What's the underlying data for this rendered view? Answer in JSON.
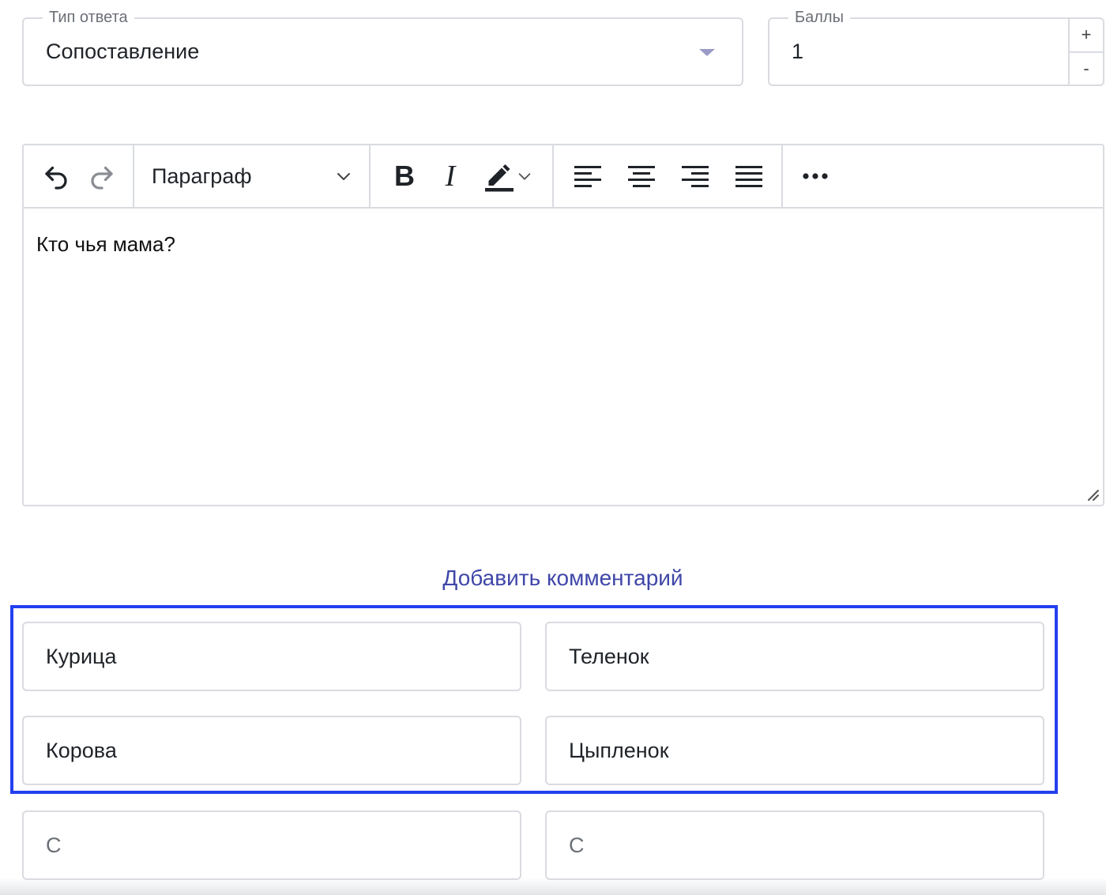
{
  "answer_type": {
    "legend": "Тип ответа",
    "value": "Сопоставление"
  },
  "points": {
    "legend": "Баллы",
    "value": "1",
    "increment_label": "+",
    "decrement_label": "-"
  },
  "editor": {
    "toolbar": {
      "undo_icon": "undo-icon",
      "redo_icon": "redo-icon",
      "block_format": "Параграф",
      "bold_label": "B",
      "italic_label": "I",
      "highlight_icon": "highlighter-icon",
      "align_left_icon": "align-left-icon",
      "align_center_icon": "align-center-icon",
      "align_right_icon": "align-right-icon",
      "justify_icon": "align-justify-icon",
      "more_icon": "more-icon"
    },
    "content": "Кто чья мама?"
  },
  "add_comment_label": "Добавить комментарий",
  "pairs": {
    "highlighted": [
      {
        "left": "Курица",
        "right": "Теленок"
      },
      {
        "left": "Корова",
        "right": "Цыпленок"
      }
    ],
    "new_row": {
      "left_placeholder": "С",
      "right_placeholder": "С"
    }
  },
  "colors": {
    "accent": "#3f46a8",
    "highlight_border": "#2340ef",
    "field_border": "#d9dbe0"
  }
}
